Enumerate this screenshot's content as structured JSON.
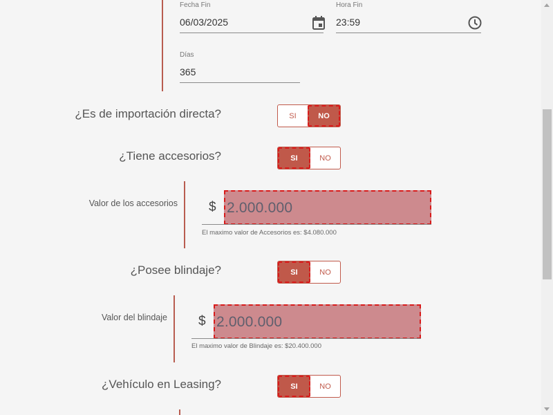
{
  "dates": {
    "end_date_label": "Fecha Fin",
    "end_date_value": "06/03/2025",
    "end_time_label": "Hora Fin",
    "end_time_value": "23:59",
    "days_label": "Días",
    "days_value": "365"
  },
  "questions": {
    "import_direct": {
      "label": "¿Es de importación directa?",
      "yes": "SI",
      "no": "NO",
      "selected": "NO"
    },
    "accessories": {
      "label": "¿Tiene accesorios?",
      "yes": "SI",
      "no": "NO",
      "selected": "SI"
    },
    "armor": {
      "label": "¿Posee blindaje?",
      "yes": "SI",
      "no": "NO",
      "selected": "SI"
    },
    "leasing": {
      "label": "¿Vehículo en Leasing?",
      "yes": "SI",
      "no": "NO",
      "selected": "SI"
    }
  },
  "accessories_value": {
    "label": "Valor de los accesorios",
    "currency": "$",
    "value": "2.000.000",
    "hint": "El maximo valor de Accesorios es: $4.080.000"
  },
  "armor_value": {
    "label": "Valor del blindaje",
    "currency": "$",
    "value": "2.000.000",
    "hint": "El maximo valor de Blindaje es: $20.400.000"
  },
  "colors": {
    "accent": "#c0594a",
    "selected_outline": "#d81b1b",
    "input_bg": "#cd8a8e"
  },
  "icons": [
    "calendar-icon",
    "clock-icon"
  ]
}
